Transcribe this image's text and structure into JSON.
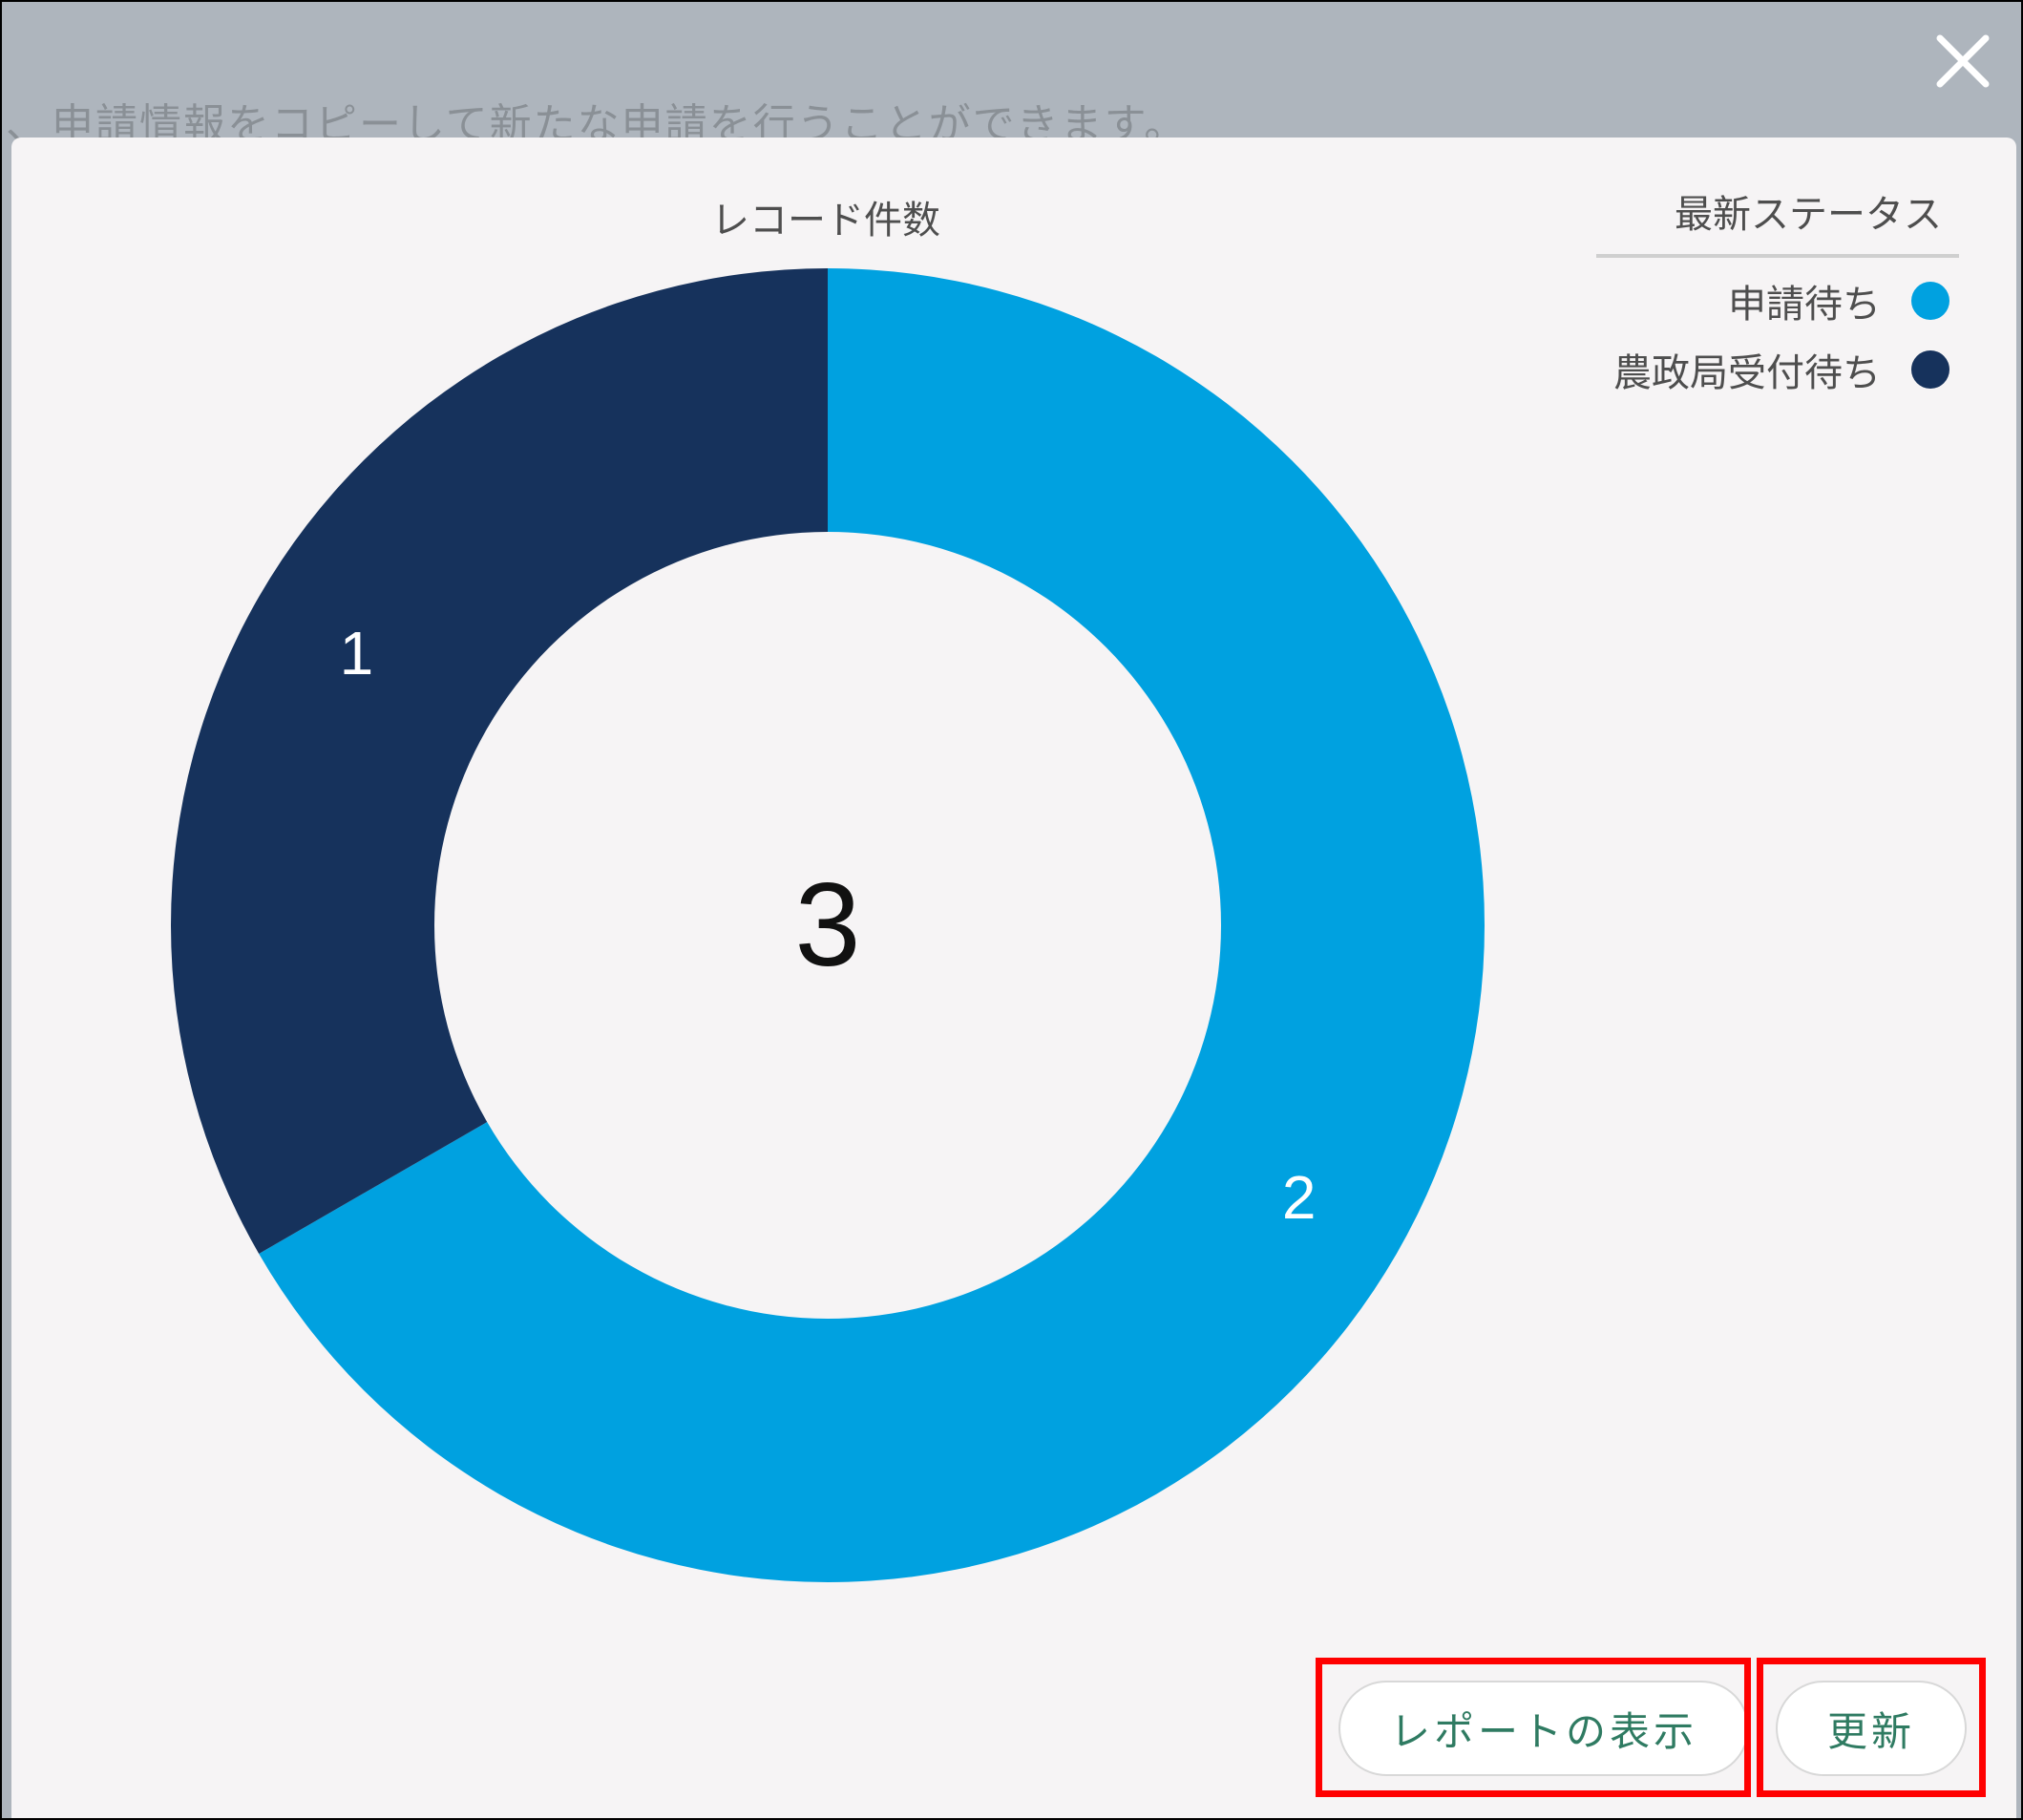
{
  "backdrop": {
    "bullet": "、",
    "text": "申請情報をコピーして新たな申請を行うことができます。"
  },
  "dialog": {
    "close_icon": "close-icon"
  },
  "chart_data": {
    "type": "pie",
    "variant": "donut",
    "title": "レコード件数",
    "center_label": "3",
    "legend_title": "最新ステータス",
    "legend_position": "top-right",
    "categories": [
      "申請待ち",
      "農政局受付待ち"
    ],
    "values": [
      2,
      1
    ],
    "data_labels": [
      "2",
      "1"
    ],
    "colors": [
      "#00a1e0",
      "#16325c"
    ]
  },
  "buttons": {
    "report_label": "レポートの表示",
    "refresh_label": "更新"
  },
  "colors": {
    "highlight": "#ff0000",
    "button_text": "#2f7b62"
  }
}
